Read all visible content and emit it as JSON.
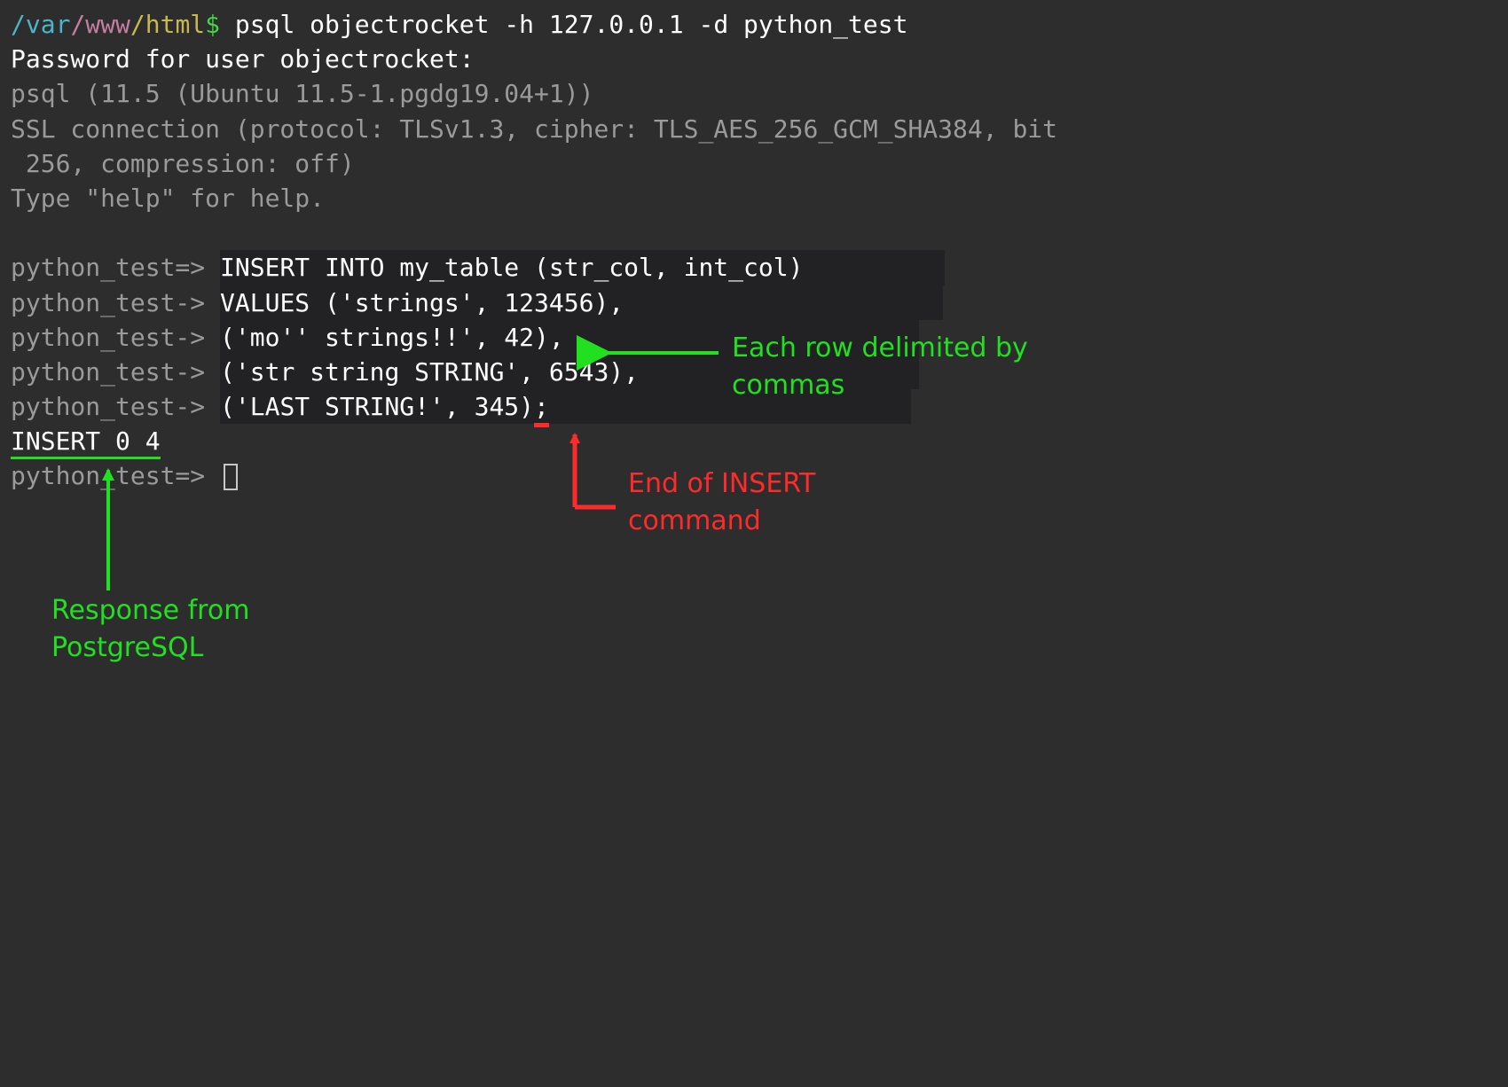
{
  "prompt": {
    "path1": "/var",
    "path2": "/www",
    "path3": "/html",
    "dollar": "$"
  },
  "cmd": " psql objectrocket -h 127.0.0.1 -d python_test",
  "lines": {
    "l2": "Password for user objectrocket:",
    "l3": "psql (11.5 (Ubuntu 11.5-1.pgdg19.04+1))",
    "l4a": "SSL connection (protocol: TLSv1.3, cipher: TLS_AES_256_GCM_SHA384, bit",
    "l4b": " 256, compression: off)",
    "l5": "Type \"help\" for help."
  },
  "sql": {
    "p_open": "python_test=> ",
    "p_cont": "python_test-> ",
    "r1": "INSERT INTO my_table (str_col, int_col)",
    "r2": "VALUES ('strings', 123456),",
    "r3_pre": "('mo'' strings!!', 42)",
    "r3_comma": ",",
    "r4": "('str string STRING', 6543),",
    "r5_pre": "('LAST STRING!', 345)",
    "r5_semi": ";",
    "resp": "INSERT 0 4"
  },
  "annotations": {
    "rows": "Each row delimited by commas",
    "end": "End of INSERT command",
    "resp": "Response from PostgreSQL"
  }
}
